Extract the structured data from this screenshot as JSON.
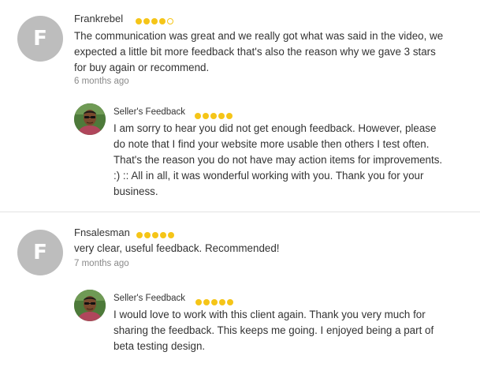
{
  "reviews": [
    {
      "avatar_letter": "F",
      "name": "Frankrebel",
      "rating": 4,
      "comment": "The communication was great and we really got what was said in the video, we expected a little bit more feedback that's also the reason why we gave 3 stars for buy again or recommend.",
      "time_ago": "6 months ago",
      "seller_label": "Seller's Feedback",
      "seller_rating": 5,
      "seller_reply": "I am sorry to hear you did not get enough feedback. However, please do note that I find your website more usable then others I test often. That's the reason you do not have may action items for improvements. :) :: All in all, it was wonderful working with you. Thank you for your business."
    },
    {
      "avatar_letter": "F",
      "name": "Fnsalesman",
      "rating": 5,
      "comment": "very clear, useful feedback. Recommended!",
      "time_ago": "7 months ago",
      "seller_label": "Seller's Feedback",
      "seller_rating": 5,
      "seller_reply": "I would love to work with this client again. Thank you very much for sharing the feedback. This keeps me going. I enjoyed being a part of beta testing design."
    }
  ],
  "colors": {
    "star": "#f5c518",
    "avatar_bg": "#bdbdbd",
    "muted_text": "#8a8a8a",
    "divider": "#e2e2e2"
  }
}
